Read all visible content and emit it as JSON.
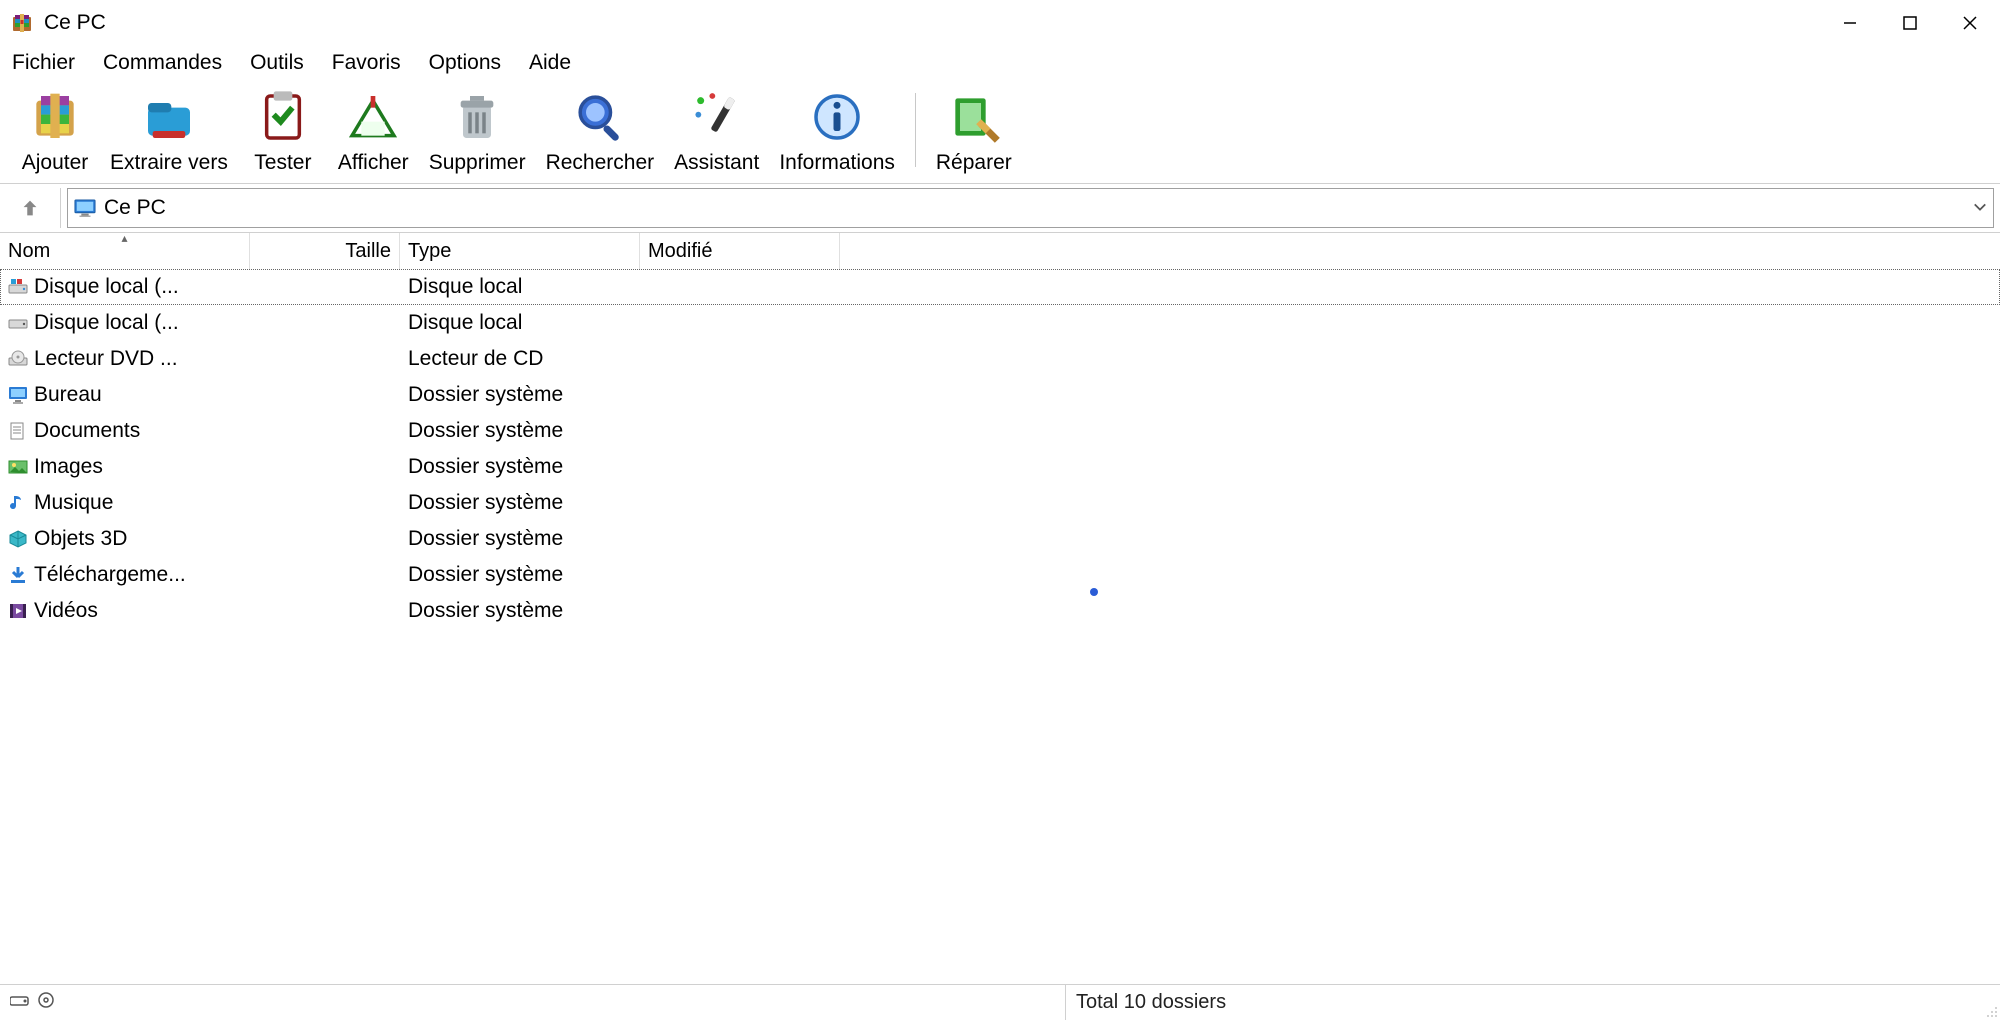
{
  "window": {
    "title": "Ce PC"
  },
  "menu": {
    "items": [
      "Fichier",
      "Commandes",
      "Outils",
      "Favoris",
      "Options",
      "Aide"
    ]
  },
  "toolbar": {
    "buttons": [
      {
        "label": "Ajouter",
        "icon": "add"
      },
      {
        "label": "Extraire vers",
        "icon": "extract"
      },
      {
        "label": "Tester",
        "icon": "test"
      },
      {
        "label": "Afficher",
        "icon": "view"
      },
      {
        "label": "Supprimer",
        "icon": "delete"
      },
      {
        "label": "Rechercher",
        "icon": "search"
      },
      {
        "label": "Assistant",
        "icon": "wizard"
      },
      {
        "label": "Informations",
        "icon": "info"
      }
    ],
    "after_sep": [
      {
        "label": "Réparer",
        "icon": "repair"
      }
    ]
  },
  "address": {
    "path": "Ce PC"
  },
  "columns": {
    "name": "Nom",
    "size": "Taille",
    "type": "Type",
    "modified": "Modifié",
    "sort_col": "name",
    "sort_dir": "asc"
  },
  "rows": [
    {
      "name": "Disque local (...",
      "type": "Disque local",
      "icon": "drive-primary",
      "focused": true
    },
    {
      "name": "Disque local (...",
      "type": "Disque local",
      "icon": "drive"
    },
    {
      "name": "Lecteur DVD ...",
      "type": "Lecteur de CD",
      "icon": "dvd"
    },
    {
      "name": "Bureau",
      "type": "Dossier système",
      "icon": "desktop"
    },
    {
      "name": "Documents",
      "type": "Dossier système",
      "icon": "documents"
    },
    {
      "name": "Images",
      "type": "Dossier système",
      "icon": "images"
    },
    {
      "name": "Musique",
      "type": "Dossier système",
      "icon": "music"
    },
    {
      "name": "Objets 3D",
      "type": "Dossier système",
      "icon": "objects3d"
    },
    {
      "name": "Téléchargeme...",
      "type": "Dossier système",
      "icon": "downloads"
    },
    {
      "name": "Vidéos",
      "type": "Dossier système",
      "icon": "videos"
    }
  ],
  "status": {
    "right": "Total 10 dossiers"
  }
}
